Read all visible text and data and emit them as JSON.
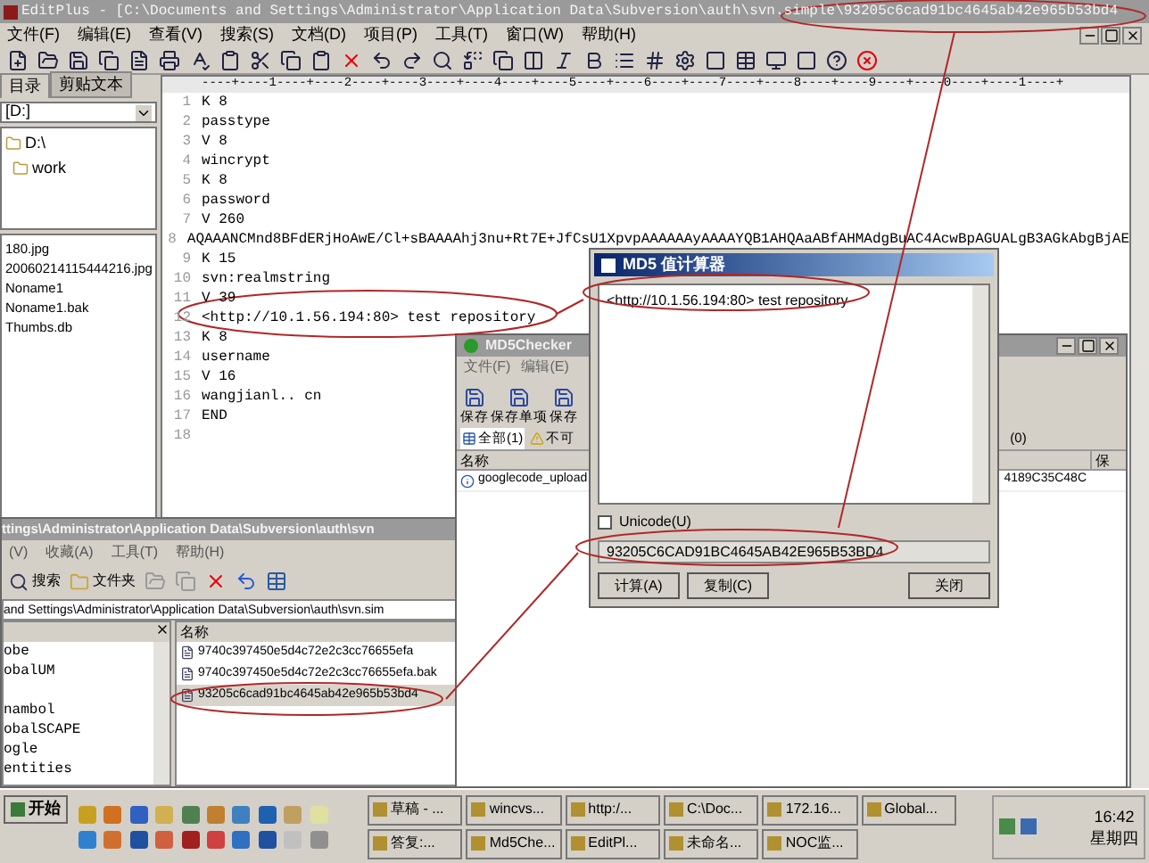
{
  "editplus": {
    "title": "EditPlus - [C:\\Documents and Settings\\Administrator\\Application Data\\Subversion\\auth\\svn.simple\\93205c6cad91bc4645ab42e965b53bd4",
    "menu": [
      "文件(F)",
      "编辑(E)",
      "查看(V)",
      "搜索(S)",
      "文档(D)",
      "项目(P)",
      "工具(T)",
      "窗口(W)",
      "帮助(H)"
    ],
    "panel_tabs": [
      {
        "label": "目录",
        "selected": true
      },
      {
        "label": "剪贴文本",
        "selected": false
      }
    ],
    "drive": "[D:]",
    "folders": [
      {
        "label": "D:\\",
        "children": [
          {
            "label": "work"
          }
        ]
      }
    ],
    "files": [
      "180.jpg",
      "20060214115444216.jpg",
      "Noname1",
      "Noname1.bak",
      "Thumbs.db"
    ],
    "ruler": "----+----1----+----2----+----3----+----4----+----5----+----6----+----7----+----8----+----9----+----0----+----1----+",
    "lines": [
      {
        "number": "1",
        "text": "K 8"
      },
      {
        "number": "2",
        "text": "passtype"
      },
      {
        "number": "3",
        "text": "V 8"
      },
      {
        "number": "4",
        "text": "wincrypt"
      },
      {
        "number": "5",
        "text": "K 8"
      },
      {
        "number": "6",
        "text": "password"
      },
      {
        "number": "7",
        "text": "V 260"
      },
      {
        "number": "8",
        "text": "AQAAANCMnd8BFdERjHoAwE/Cl+sBAAAAhj3nu+Rt7E+JfCsU1XpvpAAAAAAyAAAAYQB1AHQAaABfAHMAdgBuAC4AcwBpAGUALgB3AGkAbgBjAE"
      },
      {
        "number": "9",
        "text": "K 15"
      },
      {
        "number": "10",
        "text": "svn:realmstring"
      },
      {
        "number": "11",
        "text": "V 39"
      },
      {
        "number": "12",
        "text": "<http://10.1.56.194:80> test repository"
      },
      {
        "number": "13",
        "text": "K 8"
      },
      {
        "number": "14",
        "text": "username"
      },
      {
        "number": "15",
        "text": "V 16"
      },
      {
        "number": "16",
        "text": "wangjianl..   cn"
      },
      {
        "number": "17",
        "text": "END"
      },
      {
        "number": "18"
      }
    ]
  },
  "md5_dialog": {
    "title": "MD5 值计算器",
    "input": "<http://10.1.56.194:80> test repository",
    "unicode": {
      "label": "Unicode(U)",
      "checked": false
    },
    "result": "93205C6CAD91BC4645AB42E965B53BD4",
    "buttons": [
      "计算(A)",
      "复制(C)",
      "关闭"
    ]
  },
  "md5checker": {
    "title": "MD5Checker",
    "menu": [
      "文件(F)",
      "编辑(E)"
    ],
    "toolbar": [
      "保存",
      "保存单项",
      "保存"
    ],
    "tabs": [
      {
        "label": "全部(1)",
        "selected": true
      },
      {
        "label": "不可",
        "selected": false
      },
      {
        "label": "(0)",
        "selected": false
      }
    ],
    "columns": [
      "名称",
      "保"
    ],
    "rows": [
      {
        "name": "googlecode_upload",
        "hash": "4189C35C48C"
      }
    ]
  },
  "explorer": {
    "title": "ttings\\Administrator\\Application Data\\Subversion\\auth\\svn",
    "menu": [
      "(V)",
      "收藏(A)",
      "工具(T)",
      "帮助(H)"
    ],
    "toolbar": [
      "搜索",
      "文件夹"
    ],
    "address": "and Settings\\Administrator\\Application Data\\Subversion\\auth\\svn.sim",
    "tree": [
      "obe",
      "obalUM",
      "nambol",
      "obalSCAPE",
      "ogle",
      "entities"
    ],
    "column": "名称",
    "files": [
      {
        "name": "9740c397450e5d4c72e2c3cc76655efa",
        "selected": false
      },
      {
        "name": "9740c397450e5d4c72e2c3cc76655efa.bak",
        "selected": false
      },
      {
        "name": "93205c6cad91bc4645ab42e965b53bd4",
        "selected": true
      }
    ]
  },
  "taskbar": {
    "start": "开始",
    "tasks": [
      "草稿 - ...",
      "wincvs...",
      "http:/...",
      "C:\\Doc...",
      "172.16...",
      "Global...",
      "答复:...",
      "Md5Che...",
      "EditPl...",
      "未命名...",
      "NOC监..."
    ],
    "clock": "16:42",
    "day": "星期四"
  }
}
